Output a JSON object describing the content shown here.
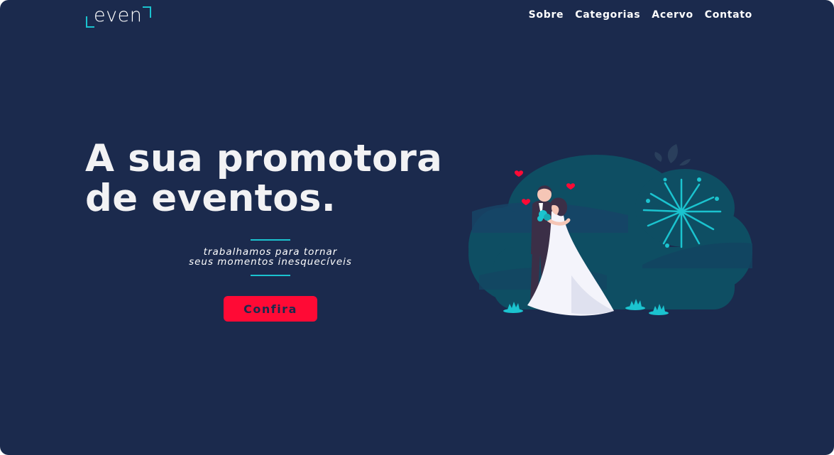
{
  "header": {
    "logo_text": "even",
    "nav": [
      "Sobre",
      "Categorias",
      "Acervo",
      "Contato"
    ]
  },
  "hero": {
    "title_line1": "A sua promotora",
    "title_line2": "de eventos.",
    "tagline_line1": "trabalhamos para tornar",
    "tagline_line2": "seus momentos inesquecíveis",
    "cta_label": "Confira"
  },
  "colors": {
    "background": "#1b2a4d",
    "accent": "#1bc3cf",
    "cta": "#ff0a35",
    "text": "#f2f2f4"
  },
  "illustration": {
    "subject": "wedding-couple-with-fireworks",
    "icons": [
      "heart-icon",
      "firework-icon",
      "leaf-icon"
    ]
  }
}
